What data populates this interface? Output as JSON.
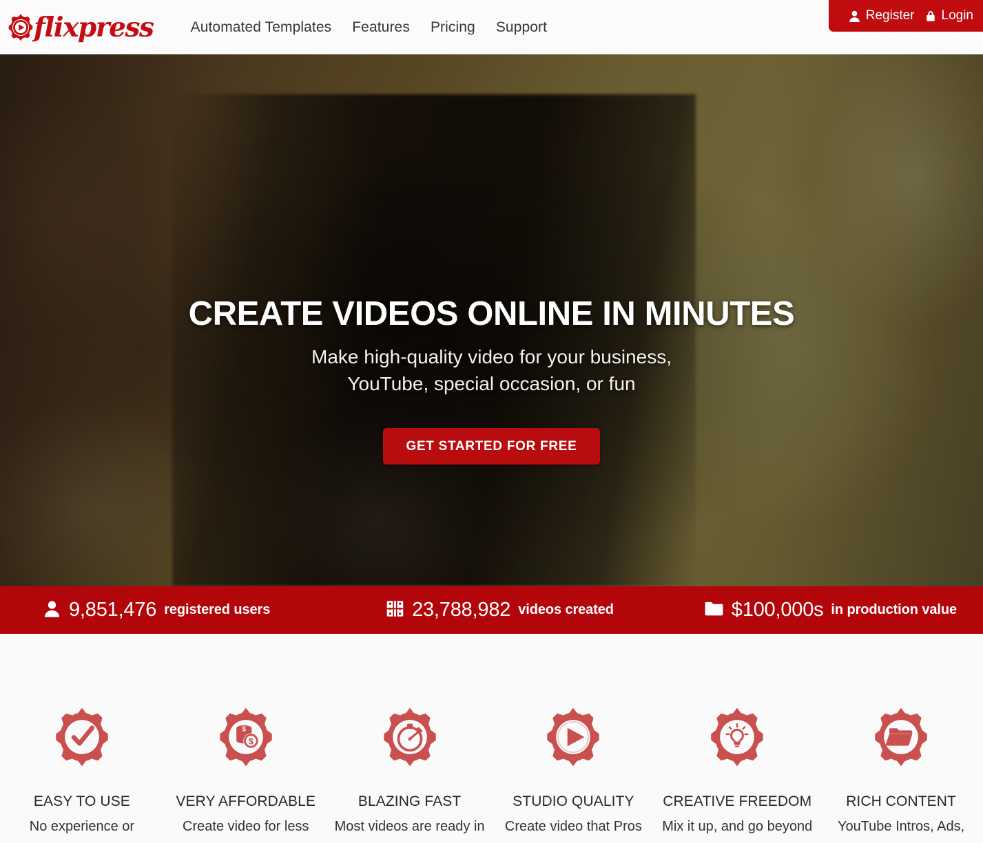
{
  "brand": {
    "name": "flixpress",
    "logo_icon": "gear-play-icon",
    "accent_red": "#c40d12",
    "bar_red": "#b3060a",
    "button_red": "#b80c0f",
    "feature_icon_red": "#c9504f"
  },
  "nav": {
    "items": [
      {
        "label": "Automated Templates",
        "name": "nav-automated-templates"
      },
      {
        "label": "Features",
        "name": "nav-features"
      },
      {
        "label": "Pricing",
        "name": "nav-pricing"
      },
      {
        "label": "Support",
        "name": "nav-support"
      }
    ]
  },
  "account": {
    "register_label": "Register",
    "register_icon": "user-icon",
    "login_label": "Login",
    "login_icon": "lock-icon"
  },
  "hero": {
    "title": "CREATE VIDEOS ONLINE IN MINUTES",
    "subtitle_line1": "Make high-quality video for your business,",
    "subtitle_line2": "YouTube, special occasion, or fun",
    "cta_label": "GET STARTED FOR FREE"
  },
  "stats": [
    {
      "icon": "user-icon",
      "value": "9,851,476",
      "label": "registered users",
      "name": "stat-registered-users"
    },
    {
      "icon": "film-icon",
      "value": "23,788,982",
      "label": "videos created",
      "name": "stat-videos-created"
    },
    {
      "icon": "folder-icon",
      "value": "$100,000s",
      "label": "in production value",
      "name": "stat-production-value"
    }
  ],
  "features": [
    {
      "icon": "gear-check-icon",
      "title": "EASY TO USE",
      "desc": "No experience or"
    },
    {
      "icon": "gear-coins-icon",
      "title": "VERY AFFORDABLE",
      "desc": "Create video for less"
    },
    {
      "icon": "gear-stopwatch-icon",
      "title": "BLAZING FAST",
      "desc": "Most videos are ready in"
    },
    {
      "icon": "gear-play-icon",
      "title": "STUDIO QUALITY",
      "desc": "Create video that Pros"
    },
    {
      "icon": "gear-lightbulb-icon",
      "title": "CREATIVE FREEDOM",
      "desc": "Mix it up, and go beyond"
    },
    {
      "icon": "gear-folder-icon",
      "title": "RICH CONTENT",
      "desc": "YouTube Intros, Ads,"
    }
  ]
}
